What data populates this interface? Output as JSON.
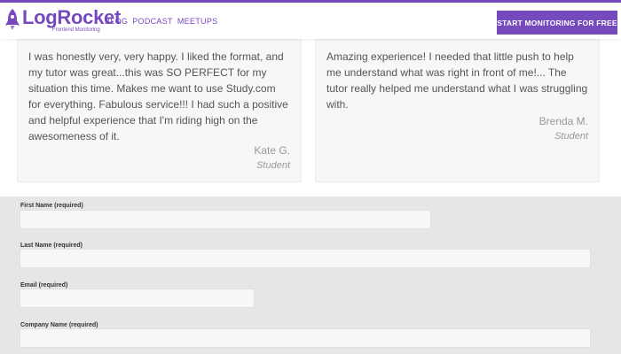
{
  "header": {
    "logo_name": "LogRocket",
    "logo_tagline": "Frontend Monitoring",
    "nav": [
      "BLOG",
      "PODCAST",
      "MEETUPS"
    ],
    "cta_label": "START MONITORING FOR FREE",
    "accent_color": "#764abc"
  },
  "testimonials": [
    {
      "text": "I was honestly very, very happy. I liked the format, and my tutor was great...this was SO PERFECT for my situation this time. Makes me want to use Study.com for everything. Fabulous service!!! I had such a positive and helpful experience that I'm riding high on the awesomeness of it.",
      "name": "Kate G.",
      "role": "Student"
    },
    {
      "text": "Amazing experience! I needed that little push to help me understand what was right in front of me!... The tutor really helped me understand what I was struggling with.",
      "name": "Brenda M.",
      "role": "Student"
    }
  ],
  "form": {
    "first_name_label": "First Name (required)",
    "last_name_label": "Last Name (required)",
    "email_label": "Email (required)",
    "company_label": "Company Name (required)",
    "first_name_value": "",
    "last_name_value": "",
    "email_value": "",
    "company_value": ""
  }
}
